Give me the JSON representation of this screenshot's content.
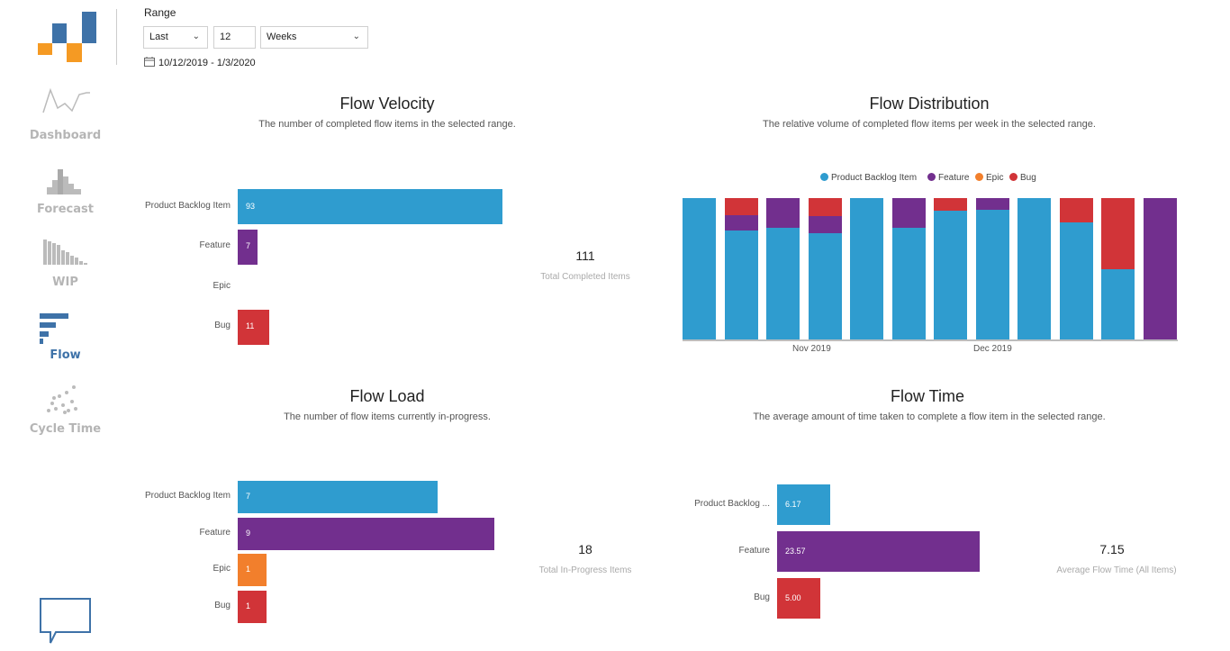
{
  "colors": {
    "pbi": "#2f9ccf",
    "feature": "#722f8e",
    "epic": "#f27f2c",
    "bug": "#d13438",
    "accent": "#3e72a8"
  },
  "sidebar": {
    "items": [
      {
        "label": "Dashboard",
        "icon": "line-chart-icon",
        "active": false
      },
      {
        "label": "Forecast",
        "icon": "histogram-icon",
        "active": false
      },
      {
        "label": "WIP",
        "icon": "aging-bars-icon",
        "active": false
      },
      {
        "label": "Flow",
        "icon": "flow-bars-icon",
        "active": true
      },
      {
        "label": "Cycle Time",
        "icon": "scatter-icon",
        "active": false
      }
    ],
    "feedback_icon": "speech-bubble-icon"
  },
  "range": {
    "label": "Range",
    "mode": "Last",
    "count": "12",
    "unit": "Weeks",
    "dates": "10/12/2019 - 1/3/2020"
  },
  "velocity": {
    "title": "Flow Velocity",
    "subtitle": "The number of completed flow items in the selected range.",
    "kpi_value": "111",
    "kpi_label": "Total Completed Items",
    "chart_data": {
      "type": "bar",
      "categories": [
        "Product Backlog Item",
        "Feature",
        "Epic",
        "Bug"
      ],
      "values": [
        93,
        7,
        0,
        11
      ],
      "value_labels": [
        "93",
        "7",
        "",
        "11"
      ]
    }
  },
  "distribution": {
    "title": "Flow Distribution",
    "subtitle": "The relative volume of completed flow items per week in the selected range.",
    "legend": [
      "Product Backlog Item",
      "Feature",
      "Epic",
      "Bug"
    ],
    "x_ticks": [
      "Nov 2019",
      "Dec 2019"
    ],
    "chart_data": {
      "type": "bar",
      "stacked": "100%",
      "series": [
        {
          "name": "Product Backlog Item",
          "values": [
            100,
            77,
            79,
            75,
            100,
            79,
            91,
            92,
            100,
            83,
            50,
            0
          ]
        },
        {
          "name": "Feature",
          "values": [
            0,
            11,
            21,
            12,
            0,
            21,
            0,
            8,
            0,
            0,
            0,
            100
          ]
        },
        {
          "name": "Epic",
          "values": [
            0,
            0,
            0,
            0,
            0,
            0,
            0,
            0,
            0,
            0,
            0,
            0
          ]
        },
        {
          "name": "Bug",
          "values": [
            0,
            12,
            0,
            13,
            0,
            0,
            9,
            0,
            0,
            17,
            50,
            0
          ]
        }
      ],
      "ylim": [
        0,
        100
      ]
    }
  },
  "load": {
    "title": "Flow Load",
    "subtitle": "The number of flow items currently in-progress.",
    "kpi_value": "18",
    "kpi_label": "Total In-Progress Items",
    "chart_data": {
      "type": "bar",
      "categories": [
        "Product Backlog Item",
        "Feature",
        "Epic",
        "Bug"
      ],
      "values": [
        7,
        9,
        1,
        1
      ],
      "value_labels": [
        "7",
        "9",
        "1",
        "1"
      ]
    }
  },
  "time": {
    "title": "Flow Time",
    "subtitle": "The average amount of time taken to complete a flow item in the selected range.",
    "kpi_value": "7.15",
    "kpi_label": "Average Flow Time (All Items)",
    "chart_data": {
      "type": "bar",
      "categories": [
        "Product Backlog ...",
        "Feature",
        "Bug"
      ],
      "values": [
        6.17,
        23.57,
        5.0
      ],
      "value_labels": [
        "6.17",
        "23.57",
        "5.00"
      ]
    }
  }
}
